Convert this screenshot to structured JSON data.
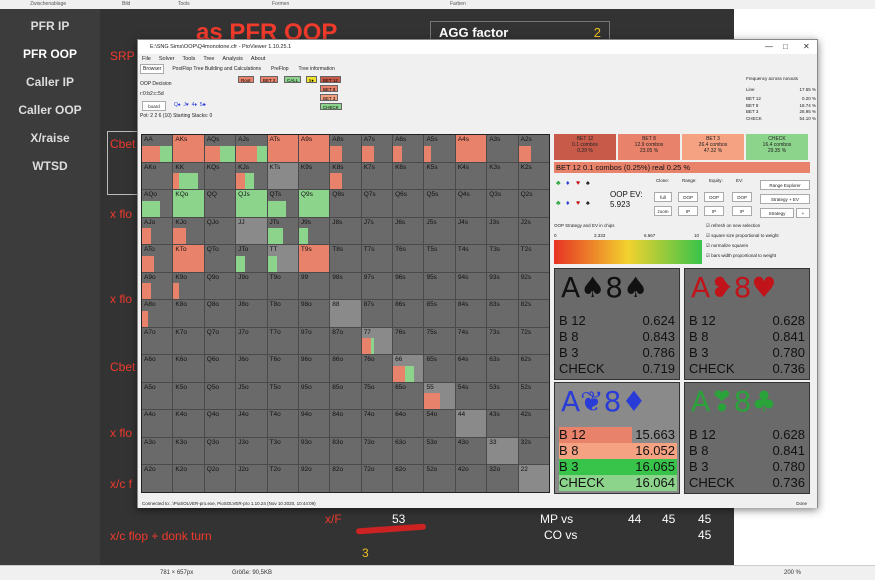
{
  "topbar": {
    "items": [
      "Zwischenablage",
      "Bild",
      "Tools",
      "Formen",
      "Farben"
    ]
  },
  "sidebar": {
    "items": [
      "PFR IP",
      "PFR OOP",
      "Caller IP",
      "Caller OOP",
      "X/raise",
      "WTSD"
    ]
  },
  "slide": {
    "title": "as PFR OOP",
    "srp": "SRP",
    "agg_label": "AGG factor",
    "agg_value": "2",
    "labels": [
      "Cbet",
      "x flo",
      "x flo",
      "Cbet",
      "x flo",
      "x/c f"
    ],
    "bottom": {
      "xf": "x/F",
      "xf_val": "53",
      "xc": "x/c flop + donk turn",
      "three": "3",
      "mp": "MP vs",
      "mp_vals": [
        "44",
        "45",
        "45"
      ],
      "co": "CO vs",
      "co_val": "45"
    }
  },
  "statusbar": {
    "left": "781 × 657px",
    "size": "Größe: 90,5KB",
    "zoom": "200 %"
  },
  "window": {
    "title": "E:\\SNG Sims\\OOP\\Q4monotone.cfr - PioViewer 1.10.25.1",
    "menu": [
      "File",
      "Solver",
      "Tools",
      "Tree",
      "Analysis",
      "About"
    ],
    "tabs": [
      "Browser",
      "PostFlop Tree Building and Calculations",
      "PreFlop",
      "Tree information"
    ],
    "decision": "OOP Decision",
    "board": "r:0:b2:c:5d",
    "board_btn": "board",
    "suits": [
      "Q♠",
      "J♥",
      "4♦",
      "5♣"
    ],
    "pot": "Pot: 2 2 6 (10) Starting Stacks: 0",
    "tree": {
      "root": "Root",
      "bet2": "BET 2",
      "call": "CALL",
      "five": "5♦",
      "bet12": "BET 12",
      "bet8": "BET 8",
      "bet3": "BET 3",
      "check": "CHECK"
    },
    "freq": {
      "title": "Frequency across runouts",
      "line_lbl": "Line",
      "line_val": "17.55 %",
      "b12": "BET 12",
      "b12v": "0.20 %",
      "b8": "BET 8",
      "b8v": "18.74 %",
      "b3": "BET 3",
      "b3v": "26.95 %",
      "ck": "CHECK",
      "ckv": "54.10 %"
    },
    "footer": "Connected to: .\\PioSOLVER-pro.exe, PioSOLVER-pro 1.10.24 (Nov 10 2020, 10:44:09)",
    "done": "Done"
  },
  "hands": [
    [
      "AA",
      "AKs",
      "AQs",
      "AJs",
      "ATs",
      "A9s",
      "A8s",
      "A7s",
      "A6s",
      "A5s",
      "A4s",
      "A3s",
      "A2s"
    ],
    [
      "AKo",
      "KK",
      "KQs",
      "KJs",
      "KTs",
      "K9s",
      "K8s",
      "K7s",
      "K6s",
      "K5s",
      "K4s",
      "K3s",
      "K2s"
    ],
    [
      "AQo",
      "KQo",
      "QQ",
      "QJs",
      "QTs",
      "Q9s",
      "Q8s",
      "Q7s",
      "Q6s",
      "Q5s",
      "Q4s",
      "Q3s",
      "Q2s"
    ],
    [
      "AJo",
      "KJo",
      "QJo",
      "JJ",
      "JTs",
      "J9s",
      "J8s",
      "J7s",
      "J6s",
      "J5s",
      "J4s",
      "J3s",
      "J2s"
    ],
    [
      "ATo",
      "KTo",
      "QTo",
      "JTo",
      "TT",
      "T9s",
      "T8s",
      "T7s",
      "T6s",
      "T5s",
      "T4s",
      "T3s",
      "T2s"
    ],
    [
      "A9o",
      "K9o",
      "Q9o",
      "J9o",
      "T9o",
      "99",
      "98s",
      "97s",
      "96s",
      "95s",
      "94s",
      "93s",
      "92s"
    ],
    [
      "A8o",
      "K8o",
      "Q8o",
      "J8o",
      "T8o",
      "98o",
      "88",
      "87s",
      "86s",
      "85s",
      "84s",
      "83s",
      "82s"
    ],
    [
      "A7o",
      "K7o",
      "Q7o",
      "J7o",
      "T7o",
      "97o",
      "87o",
      "77",
      "76s",
      "75s",
      "74s",
      "73s",
      "72s"
    ],
    [
      "A6o",
      "K6o",
      "Q6o",
      "J6o",
      "T6o",
      "96o",
      "86o",
      "76o",
      "66",
      "65s",
      "64s",
      "63s",
      "62s"
    ],
    [
      "A5o",
      "K5o",
      "Q5o",
      "J5o",
      "T5o",
      "95o",
      "85o",
      "75o",
      "65o",
      "55",
      "54s",
      "53s",
      "52s"
    ],
    [
      "A4o",
      "K4o",
      "Q4o",
      "J4o",
      "T4o",
      "94o",
      "84o",
      "74o",
      "64o",
      "54o",
      "44",
      "43s",
      "42s"
    ],
    [
      "A3o",
      "K3o",
      "Q3o",
      "J3o",
      "T3o",
      "93o",
      "83o",
      "73o",
      "63o",
      "53o",
      "43o",
      "33",
      "32s"
    ],
    [
      "A2o",
      "K2o",
      "Q2o",
      "J2o",
      "T2o",
      "92o",
      "82o",
      "72o",
      "62o",
      "52o",
      "42o",
      "32o",
      "22"
    ]
  ],
  "actions": [
    {
      "name": "BET 12",
      "combos": "0.1 combos",
      "pct": "0.29 %",
      "color": "#c85a4a"
    },
    {
      "name": "BET 8",
      "combos": "12.9 combos",
      "pct": "23.05 %",
      "color": "#e8826a"
    },
    {
      "name": "BET 3",
      "combos": "26.4 combos",
      "pct": "47.32 %",
      "color": "#f4a282"
    },
    {
      "name": "CHECK",
      "combos": "16.4 combos",
      "pct": "29.35 %",
      "color": "#8cd48c"
    }
  ],
  "summary": {
    "text": "BET 12   0.1 combos (0.25%) real  0.25 %"
  },
  "controls": {
    "clone": "Clone:",
    "range": "Range:",
    "equity": "Equity:",
    "ev": "EV:",
    "ev_lbl": "OOP EV:",
    "ev_val": "5.923",
    "btns_top": [
      "full",
      "OOP",
      "OOP",
      "OOP"
    ],
    "btns_bot": [
      "zoom",
      "IP",
      "IP",
      "IP"
    ],
    "range_explorer": "Range Explorer",
    "strategy_ev": "Strategy + EV",
    "strategy": "Strategy",
    "plus": "+",
    "chart_lbl": "OOP Strategy and EV in chips",
    "scale": [
      "0",
      "3.333",
      "6.667",
      "10"
    ],
    "checks": [
      "refresh on new selection",
      "square size proportional to weight",
      "normalize squares",
      "bars width proportional to weight"
    ]
  },
  "cards": [
    {
      "title": "A♠8♠",
      "color": "#111",
      "rows": [
        [
          "B 12",
          "0.624"
        ],
        [
          "B 8",
          "0.843"
        ],
        [
          "B 3",
          "0.786"
        ],
        [
          "CHECK",
          "0.719"
        ]
      ]
    },
    {
      "title": "A❥8♥",
      "color": "#c0141a",
      "rows": [
        [
          "B 12",
          "0.628"
        ],
        [
          "B 8",
          "0.841"
        ],
        [
          "B 3",
          "0.780"
        ],
        [
          "CHECK",
          "0.736"
        ]
      ]
    },
    {
      "title": "A❦8♦",
      "color": "#2a3cd8",
      "rows": [
        [
          "B 12",
          "15.663"
        ],
        [
          "B 8",
          "16.052"
        ],
        [
          "B 3",
          "16.065"
        ],
        [
          "CHECK",
          "16.064"
        ]
      ]
    },
    {
      "title": "A❣8♣",
      "color": "#2aa33a",
      "rows": [
        [
          "B 12",
          "0.628"
        ],
        [
          "B 8",
          "0.841"
        ],
        [
          "B 3",
          "0.780"
        ],
        [
          "CHECK",
          "0.736"
        ]
      ]
    }
  ]
}
